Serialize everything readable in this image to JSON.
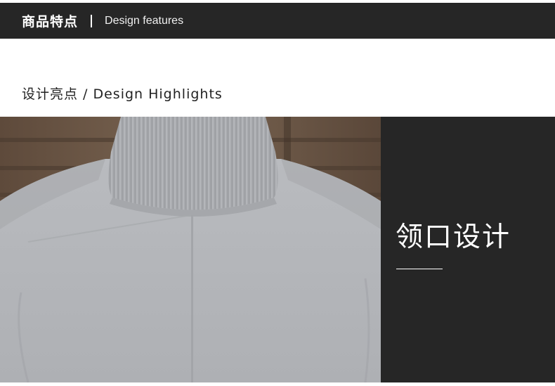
{
  "header": {
    "title_cn": "商品特点",
    "separator": "|",
    "title_en": "Design features"
  },
  "section": {
    "subtitle": "设计亮点 / Design Highlights"
  },
  "panel": {
    "title": "领口设计"
  },
  "photo": {
    "subject": "sweater-photo"
  },
  "colors": {
    "header_bg": "#262626",
    "panel_bg": "#262626",
    "text_dark": "#222222",
    "text_light": "#ffffff",
    "sweater": "#b3b5b8"
  }
}
